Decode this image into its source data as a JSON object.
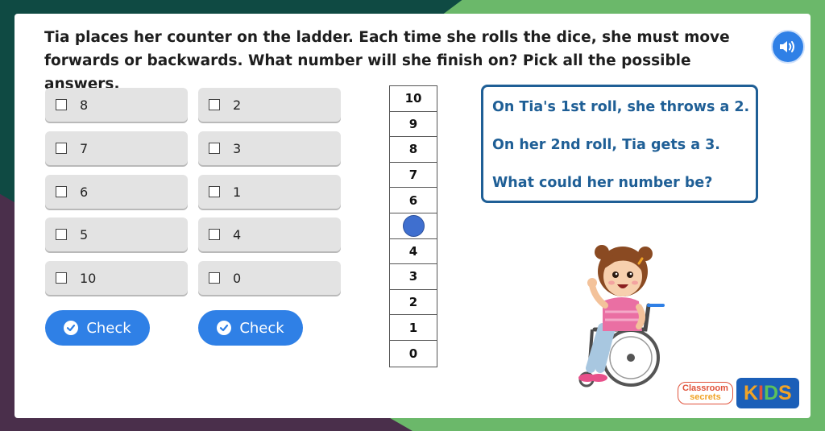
{
  "question": {
    "line1": "Tia places her counter on the ladder. Each time she rolls the dice, she must move",
    "line2": "forwards or backwards. What number will she finish on? Pick all the possible answers."
  },
  "audio_icon": "speaker-icon",
  "options_left": [
    "8",
    "7",
    "6",
    "5",
    "10"
  ],
  "options_right": [
    "2",
    "3",
    "1",
    "4",
    "0"
  ],
  "check_label": "Check",
  "ladder": [
    "10",
    "9",
    "8",
    "7",
    "6",
    "",
    "4",
    "3",
    "2",
    "1",
    "0"
  ],
  "counter_rung": "5",
  "info": {
    "line1": "On Tia's 1st roll, she throws a 2.",
    "line2": "On her 2nd roll, Tia gets a 3.",
    "line3": "What could her number be?"
  },
  "logo": {
    "brand_line1": "Classroom",
    "brand_line2": "secrets",
    "kids_k": "K",
    "kids_i": "I",
    "kids_d": "D",
    "kids_s": "S"
  },
  "colors": {
    "accent": "#2f80e6",
    "info_text": "#1f5f96",
    "counter": "#3f6fcf"
  }
}
